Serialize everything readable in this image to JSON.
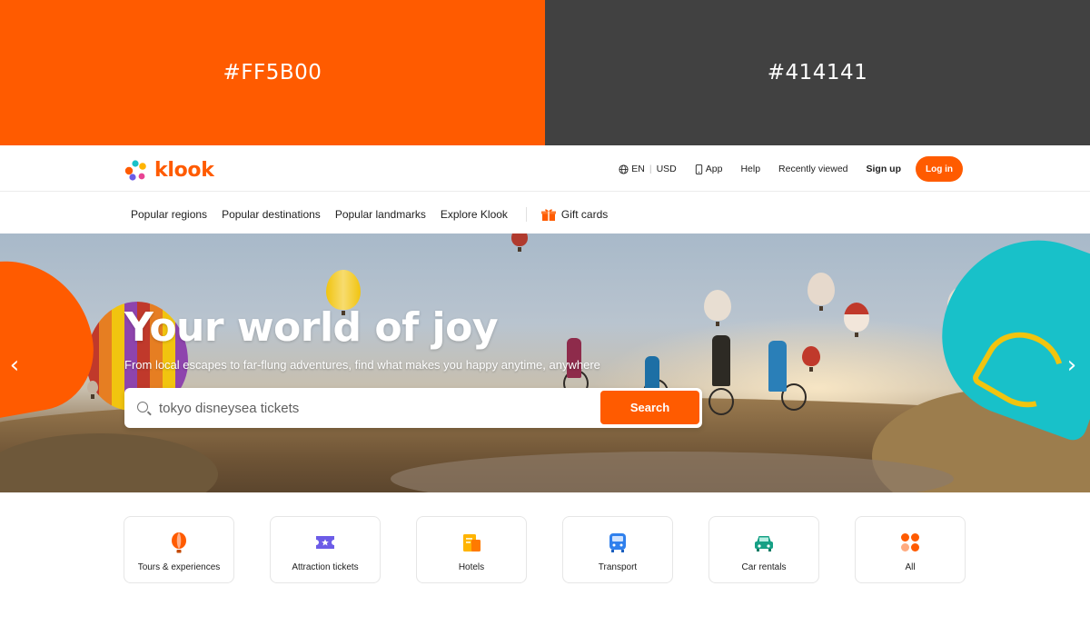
{
  "swatches": [
    {
      "label": "#FF5B00",
      "color": "#FF5B00"
    },
    {
      "label": "#414141",
      "color": "#414141"
    }
  ],
  "brand": {
    "name": "klook",
    "color": "#FF5B00"
  },
  "topnav": {
    "lang": "EN",
    "currency": "USD",
    "app": "App",
    "help": "Help",
    "recently_viewed": "Recently viewed",
    "signup": "Sign up",
    "login": "Log in"
  },
  "subnav": {
    "items": [
      "Popular regions",
      "Popular destinations",
      "Popular landmarks",
      "Explore Klook"
    ],
    "gift_cards": "Gift cards"
  },
  "hero": {
    "title": "Your world of joy",
    "subtitle": "From local escapes to far-flung adventures, find what makes you happy anytime, anywhere",
    "search_value": "tokyo disneysea tickets",
    "search_button": "Search"
  },
  "categories": [
    {
      "label": "Tours & experiences",
      "icon": "hot-air-balloon-icon",
      "color": "#FF5B00"
    },
    {
      "label": "Attraction tickets",
      "icon": "ticket-icon",
      "color": "#6c5ce7"
    },
    {
      "label": "Hotels",
      "icon": "hotel-icon",
      "color": "#ffb400"
    },
    {
      "label": "Transport",
      "icon": "bus-icon",
      "color": "#2f80ed"
    },
    {
      "label": "Car rentals",
      "icon": "car-icon",
      "color": "#16a085"
    },
    {
      "label": "All",
      "icon": "grid-icon",
      "color": "#FF5B00"
    }
  ]
}
